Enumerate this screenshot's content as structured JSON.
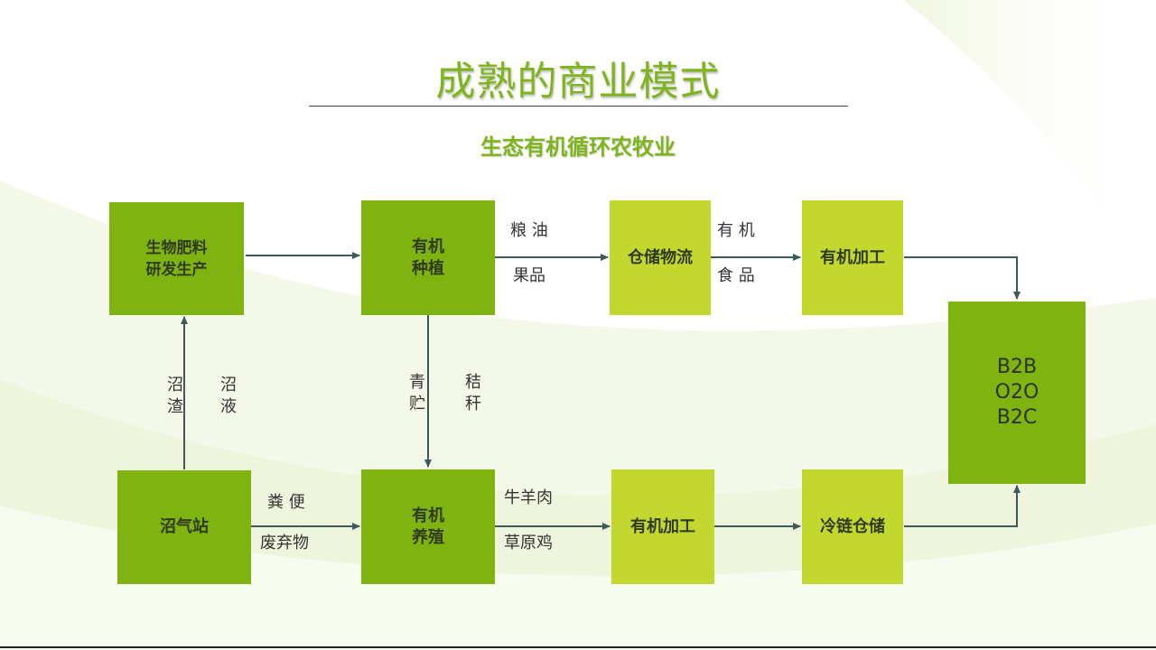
{
  "title": "成熟的商业模式",
  "subtitle": "生态有机循环农牧业",
  "nodes": {
    "fertilizer": "生物肥料\n研发生产",
    "planting": "有机\n种植",
    "storage": "仓储物流",
    "processing_top": "有机加工",
    "b2b": "B2B\nO2O\nB2C",
    "biogas": "沼气站",
    "breeding": "有机\n养殖",
    "processing_bottom": "有机加工",
    "coldchain": "冷链仓储"
  },
  "edge_labels": {
    "grain_oil": "粮 油",
    "fruit": "果品",
    "organic": "有 机",
    "food": "食 品",
    "residue": "沼\n渣",
    "liquid": "沼\n液",
    "silage": "青\n贮",
    "straw": "秸\n秆",
    "manure": "粪 便",
    "waste": "废弃物",
    "beef_mutton": "牛羊肉",
    "chicken": "草原鸡"
  },
  "colors": {
    "dark_box": "#7fb30f",
    "light_box": "#c3d82f",
    "arrow": "#3d5a5a",
    "title": "#7fb51c"
  }
}
